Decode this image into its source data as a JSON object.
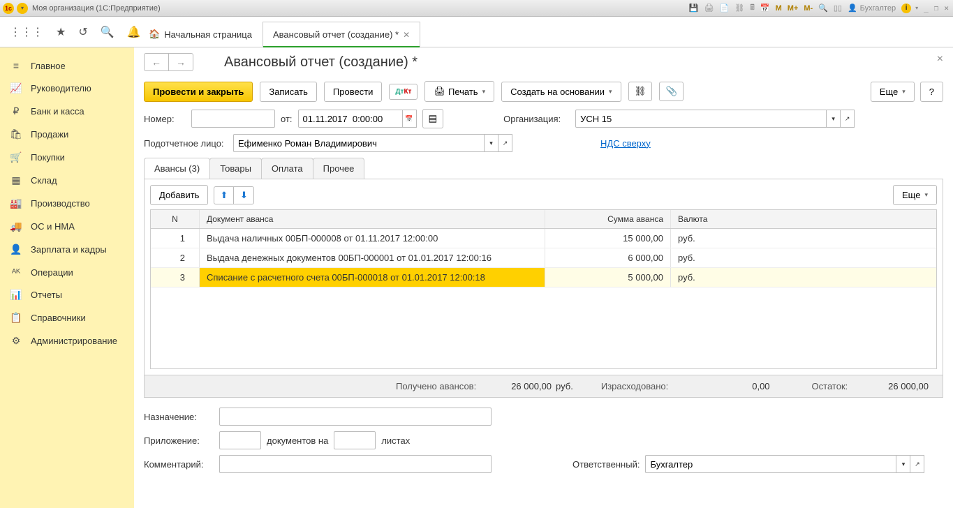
{
  "titlebar": {
    "org": "Моя организация",
    "app": "(1С:Предприятие)",
    "user": "Бухгалтер",
    "m": "M",
    "mplus": "M+",
    "mminus": "M-"
  },
  "topTabs": {
    "home": "Начальная страница",
    "active": "Авансовый отчет (создание) *"
  },
  "sidebar": [
    {
      "icon": "≡",
      "label": "Главное"
    },
    {
      "icon": "📈",
      "label": "Руководителю"
    },
    {
      "icon": "₽",
      "label": "Банк и касса"
    },
    {
      "icon": "🛍",
      "label": "Продажи"
    },
    {
      "icon": "🛒",
      "label": "Покупки"
    },
    {
      "icon": "▦",
      "label": "Склад"
    },
    {
      "icon": "🏭",
      "label": "Производство"
    },
    {
      "icon": "🚚",
      "label": "ОС и НМА"
    },
    {
      "icon": "👤",
      "label": "Зарплата и кадры"
    },
    {
      "icon": "ᴬᴷ",
      "label": "Операции"
    },
    {
      "icon": "📊",
      "label": "Отчеты"
    },
    {
      "icon": "📋",
      "label": "Справочники"
    },
    {
      "icon": "⚙",
      "label": "Администрирование"
    }
  ],
  "page": {
    "title": "Авансовый отчет (создание) *",
    "actions": {
      "postClose": "Провести и закрыть",
      "save": "Записать",
      "post": "Провести",
      "print": "Печать",
      "createBasis": "Создать на основании",
      "more": "Еще"
    },
    "fields": {
      "numberLabel": "Номер:",
      "numberValue": "",
      "fromLabel": "от:",
      "dateValue": "01.11.2017  0:00:00",
      "orgLabel": "Организация:",
      "orgValue": "УСН 15",
      "personLabel": "Подотчетное лицо:",
      "personValue": "Ефименко Роман Владимирович",
      "ndsLabel": "НДС сверху"
    },
    "dataTabs": [
      "Авансы (3)",
      "Товары",
      "Оплата",
      "Прочее"
    ],
    "panel": {
      "add": "Добавить",
      "more": "Еще",
      "columns": {
        "n": "N",
        "doc": "Документ аванса",
        "sum": "Сумма аванса",
        "cur": "Валюта"
      },
      "rows": [
        {
          "n": "1",
          "doc": "Выдача наличных 00БП-000008 от 01.11.2017 12:00:00",
          "sum": "15 000,00",
          "cur": "руб."
        },
        {
          "n": "2",
          "doc": "Выдача денежных документов 00БП-000001 от 01.01.2017 12:00:16",
          "sum": "6 000,00",
          "cur": "руб."
        },
        {
          "n": "3",
          "doc": "Списание с расчетного счета 00БП-000018 от 01.01.2017 12:00:18",
          "sum": "5 000,00",
          "cur": "руб."
        }
      ]
    },
    "totals": {
      "receivedLabel": "Получено авансов:",
      "receivedValue": "26 000,00",
      "receivedCur": "руб.",
      "spentLabel": "Израсходовано:",
      "spentValue": "0,00",
      "balanceLabel": "Остаток:",
      "balanceValue": "26 000,00"
    },
    "bottom": {
      "purposeLabel": "Назначение:",
      "purposeValue": "",
      "attachLabel": "Приложение:",
      "attachDocs": "",
      "attachDocsLabel": "документов на",
      "attachSheets": "",
      "attachSheetsLabel": "листах",
      "commentLabel": "Комментарий:",
      "commentValue": "",
      "responsibleLabel": "Ответственный:",
      "responsibleValue": "Бухгалтер"
    }
  }
}
